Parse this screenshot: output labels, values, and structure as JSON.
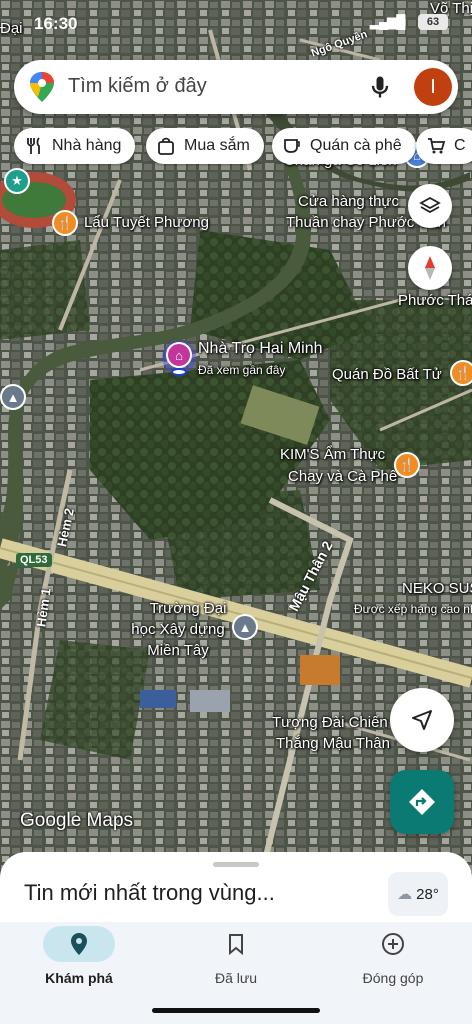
{
  "status_bar": {
    "time": "16:30",
    "battery": "63"
  },
  "search": {
    "placeholder": "Tìm kiếm ở đây",
    "avatar_initial": "I"
  },
  "chips": [
    {
      "label": "Nhà hàng",
      "icon": "restaurant-icon"
    },
    {
      "label": "Mua sắm",
      "icon": "shopping-bag-icon"
    },
    {
      "label": "Quán cà phê",
      "icon": "coffee-icon"
    },
    {
      "label": "C",
      "icon": "cart-icon"
    }
  ],
  "map": {
    "places": {
      "lau_tuyet_phuong": "Lẩu Tuyết Phương",
      "nha_tro": "Nhà Trọ Hai Minh",
      "nha_tro_sub": "Đã xem gần đây",
      "cua_hang_1": "Cửa hàng thực",
      "cua_hang_2": "Thuần chay Phước Cần",
      "phuoc_thai": "Phước Thá",
      "chan_ga": "Chân gà Cô Liên",
      "quan_do_bat_tu": "Quán Đồ Bất Tử",
      "kims_1": "KIM'S Ẩm Thực",
      "kims_2": "Chay và Cà Phê",
      "neko_1": "NEKO SUS",
      "neko_2": "Được xếp hạng cao nh",
      "truong_1": "Trường Đại",
      "truong_2": "học Xây dựng",
      "truong_3": "Miền Tây",
      "tuong_dai_1": "Tượng Đài Chiến",
      "tuong_dai_2": "Thắng Mậu Thân",
      "top_left_1": "Đại",
      "top_right": "Võ Thị",
      "street_top": "Ngô Quyền"
    },
    "roads": {
      "ql53": "QL53",
      "hem2": "Hẻm 2",
      "hem1": "Hẻm 1",
      "mau_than2": "Mậu Thân 2"
    },
    "watermark": "Google Maps"
  },
  "weather": {
    "temp": "28°"
  },
  "sheet": {
    "title": "Tin mới nhất trong vùng..."
  },
  "nav": [
    {
      "label": "Khám phá",
      "icon": "explore-pin-icon",
      "active": true
    },
    {
      "label": "Đã lưu",
      "icon": "bookmark-icon",
      "active": false
    },
    {
      "label": "Đóng góp",
      "icon": "add-circle-icon",
      "active": false
    }
  ],
  "colors": {
    "accent": "#0b7a72",
    "avatar": "#c0410f",
    "poi_orange": "#f28b20",
    "nav_active": "#c9e6ef"
  }
}
